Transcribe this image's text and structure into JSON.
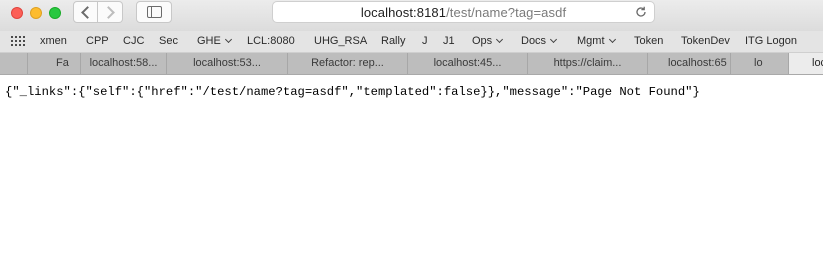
{
  "window": {
    "url_host": "localhost:8181",
    "url_path": "/test/name?tag=asdf"
  },
  "toolbar": {
    "back_icon": "chevron-left-icon",
    "forward_icon": "chevron-right-icon",
    "sidebar_icon": "sidebar-icon",
    "reload_icon": "reload-icon"
  },
  "bookmarks": [
    {
      "label": "xmen"
    },
    {
      "label": "CPP"
    },
    {
      "label": "CJC"
    },
    {
      "label": "Sec"
    },
    {
      "label": "GHE",
      "menu": true
    },
    {
      "label": "LCL:8080"
    },
    {
      "label": "UHG_RSA"
    },
    {
      "label": "Rally"
    },
    {
      "label": "J"
    },
    {
      "label": "J1"
    },
    {
      "label": "Ops",
      "menu": true
    },
    {
      "label": "Docs",
      "menu": true
    },
    {
      "label": "Mgmt",
      "menu": true
    },
    {
      "label": "Token"
    },
    {
      "label": "TokenDev"
    },
    {
      "label": "ITG Logon"
    }
  ],
  "tabs": [
    {
      "label": "Fa"
    },
    {
      "label": "localhost:58..."
    },
    {
      "label": "localhost:53..."
    },
    {
      "label": "Refactor: rep..."
    },
    {
      "label": "localhost:45..."
    },
    {
      "label": "https://claim..."
    },
    {
      "label": "localhost:65"
    },
    {
      "label": "lo"
    },
    {
      "label": "loc",
      "active": true
    }
  ],
  "body_text": "{\"_links\":{\"self\":{\"href\":\"/test/name?tag=asdf\",\"templated\":false}},\"message\":\"Page Not Found\"}"
}
